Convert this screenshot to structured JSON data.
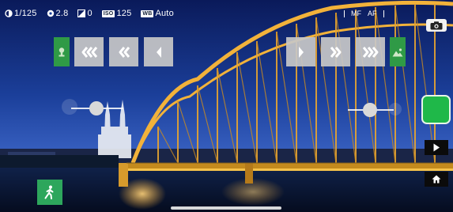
{
  "status": {
    "shutter": "1/125",
    "aperture": "2.8",
    "exposure_comp": "0",
    "iso_tag": "ISO",
    "iso": "125",
    "wb_tag": "WB",
    "wb": "Auto"
  },
  "focus": {
    "mode": "MF",
    "auto": "AF"
  },
  "left_steps": [
    {
      "name": "step-back-large-button",
      "icon": "triple-chevron-left-icon"
    },
    {
      "name": "step-back-medium-button",
      "icon": "double-chevron-left-icon"
    },
    {
      "name": "step-back-small-button",
      "icon": "single-chevron-left-icon"
    }
  ],
  "right_steps": [
    {
      "name": "step-forward-small-button",
      "icon": "single-chevron-right-icon"
    },
    {
      "name": "step-forward-medium-button",
      "icon": "double-chevron-right-icon"
    },
    {
      "name": "step-forward-large-button",
      "icon": "triple-chevron-right-icon"
    }
  ],
  "icons": {
    "camera_switch": "camera-switch-icon",
    "near_focus": "near-focus-icon",
    "far_focus": "landscape-icon",
    "play": "play-icon",
    "home": "home-icon",
    "timelapse": "walking-person-icon"
  },
  "colors": {
    "accent_green": "#1fb849",
    "badge_green": "#2f9a46",
    "button_grey": "#c8c8c8",
    "dark_button": "#0b0b0b"
  }
}
